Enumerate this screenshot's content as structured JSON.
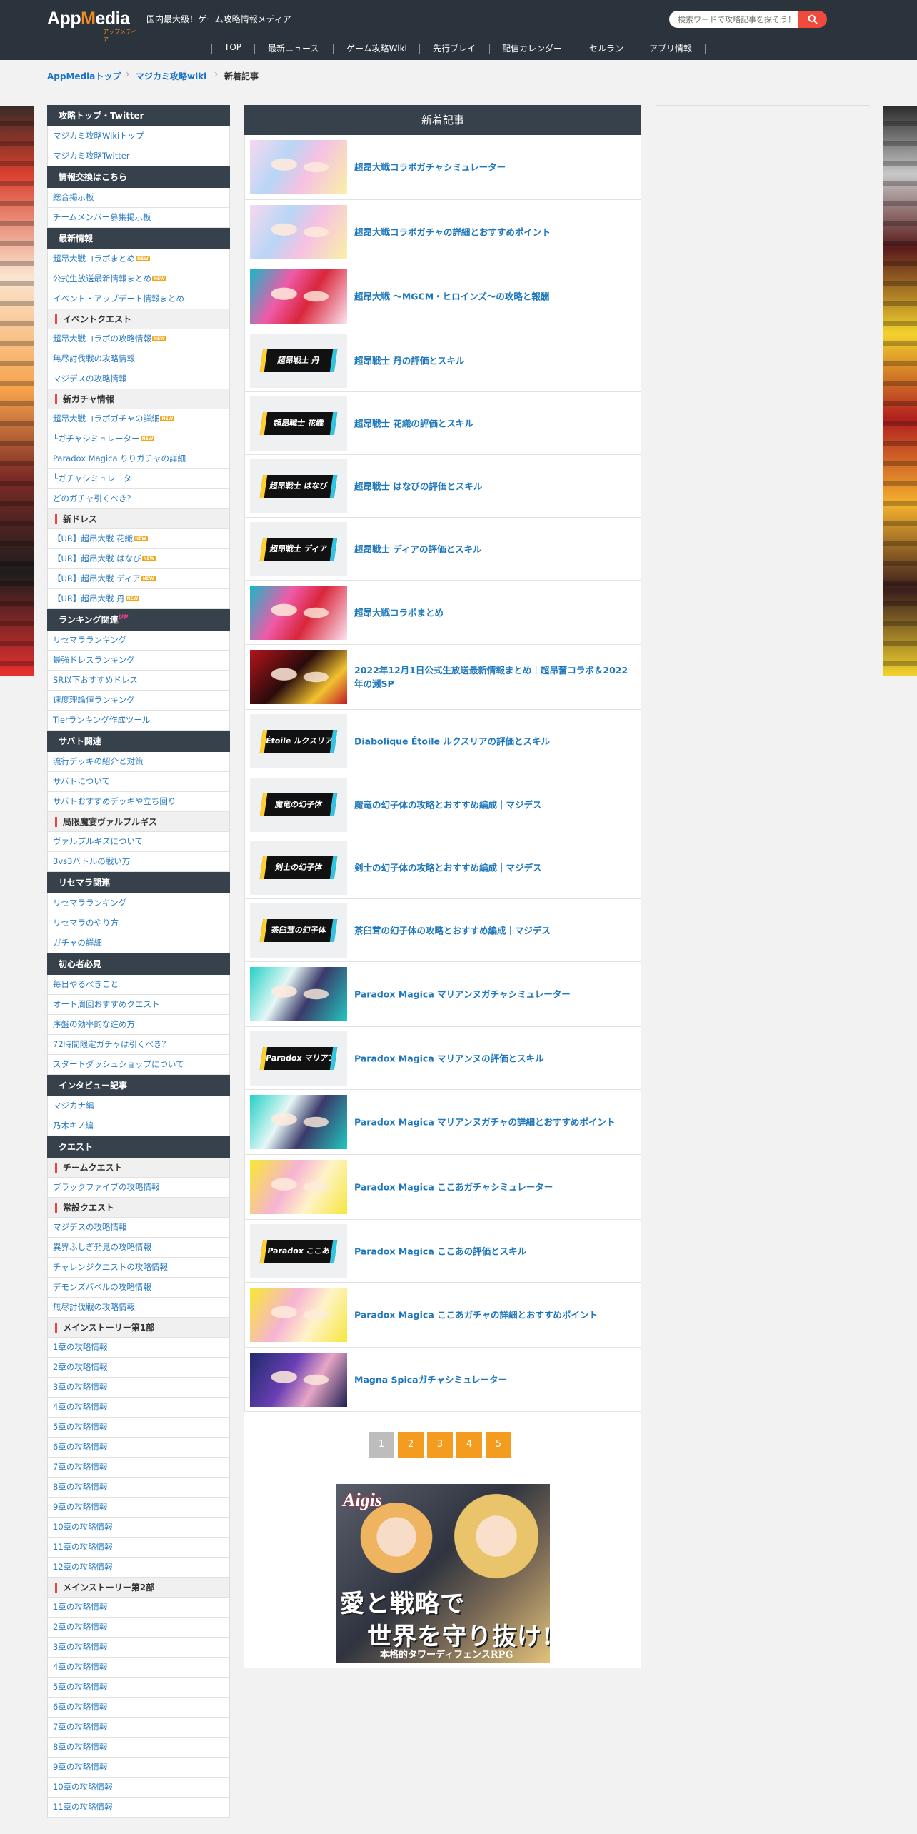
{
  "header": {
    "logo_text_a": "App",
    "logo_text_m": "M",
    "logo_text_b": "edia",
    "logo_kana": "アップメディア",
    "tagline": "国内最大級！ゲーム攻略情報メディア",
    "search_placeholder": "検索ワードで攻略記事を探そう！",
    "nav": [
      "TOP",
      "最新ニュース",
      "ゲーム攻略Wiki",
      "先行プレイ",
      "配信カレンダー",
      "セルラン",
      "アプリ情報"
    ]
  },
  "breadcrumb": {
    "items": [
      "AppMediaトップ",
      "マジカミ攻略wiki"
    ],
    "current": "新着記事"
  },
  "sidebar": {
    "sections": [
      {
        "type": "head",
        "label": "攻略トップ・Twitter"
      },
      {
        "type": "item",
        "label": "マジカミ攻略Wikiトップ"
      },
      {
        "type": "item",
        "label": "マジカミ攻略Twitter"
      },
      {
        "type": "head",
        "label": "情報交換はこちら"
      },
      {
        "type": "item",
        "label": "総合掲示板"
      },
      {
        "type": "item",
        "label": "チームメンバー募集掲示板"
      },
      {
        "type": "head",
        "label": "最新情報"
      },
      {
        "type": "item",
        "label": "超昂大戦コラボまとめ",
        "badge": "NEW"
      },
      {
        "type": "item",
        "label": "公式生放送最新情報まとめ",
        "badge": "NEW"
      },
      {
        "type": "item",
        "label": "イベント・アップデート情報まとめ"
      },
      {
        "type": "sub",
        "label": "イベントクエスト"
      },
      {
        "type": "item",
        "label": "超昂大戦コラボの攻略情報",
        "badge": "NEW"
      },
      {
        "type": "item",
        "label": "無尽討伐戦の攻略情報"
      },
      {
        "type": "item",
        "label": "マジデスの攻略情報"
      },
      {
        "type": "sub",
        "label": "新ガチャ情報"
      },
      {
        "type": "item",
        "label": "超昂大戦コラボガチャの詳細",
        "badge": "NEW"
      },
      {
        "type": "item",
        "label": "└ガチャシミュレーター",
        "badge": "NEW"
      },
      {
        "type": "item",
        "label": "Paradox Magica りりガチャの詳細"
      },
      {
        "type": "item",
        "label": "└ガチャシミュレーター"
      },
      {
        "type": "item",
        "label": "どのガチャ引くべき？"
      },
      {
        "type": "sub",
        "label": "新ドレス"
      },
      {
        "type": "item",
        "label": "【UR】超昂大戦 花織",
        "badge": "NEW"
      },
      {
        "type": "item",
        "label": "【UR】超昂大戦 はなび",
        "badge": "NEW"
      },
      {
        "type": "item",
        "label": "【UR】超昂大戦 ディア",
        "badge": "NEW"
      },
      {
        "type": "item",
        "label": "【UR】超昂大戦 丹",
        "badge": "NEW"
      },
      {
        "type": "head",
        "label": "ランキング関連",
        "up": "UP"
      },
      {
        "type": "item",
        "label": "リセマラランキング"
      },
      {
        "type": "item",
        "label": "最強ドレスランキング"
      },
      {
        "type": "item",
        "label": "SR以下おすすめドレス"
      },
      {
        "type": "item",
        "label": "速度理論値ランキング"
      },
      {
        "type": "item",
        "label": "Tierランキング作成ツール"
      },
      {
        "type": "head",
        "label": "サバト関連"
      },
      {
        "type": "item",
        "label": "流行デッキの紹介と対策"
      },
      {
        "type": "item",
        "label": "サバトについて"
      },
      {
        "type": "item",
        "label": "サバトおすすめデッキや立ち回り"
      },
      {
        "type": "sub",
        "label": "局限魔宴ヴァルプルギス"
      },
      {
        "type": "item",
        "label": "ヴァルプルギスについて"
      },
      {
        "type": "item",
        "label": "3vs3バトルの戦い方"
      },
      {
        "type": "head",
        "label": "リセマラ関連"
      },
      {
        "type": "item",
        "label": "リセマラランキング"
      },
      {
        "type": "item",
        "label": "リセマラのやり方"
      },
      {
        "type": "item",
        "label": "ガチャの詳細"
      },
      {
        "type": "head",
        "label": "初心者必見"
      },
      {
        "type": "item",
        "label": "毎日やるべきこと"
      },
      {
        "type": "item",
        "label": "オート周回おすすめクエスト"
      },
      {
        "type": "item",
        "label": "序盤の効率的な進め方"
      },
      {
        "type": "item",
        "label": "72時間限定ガチャは引くべき？"
      },
      {
        "type": "item",
        "label": "スタートダッシュショップについて"
      },
      {
        "type": "head",
        "label": "インタビュー記事"
      },
      {
        "type": "item",
        "label": "マジカナ編"
      },
      {
        "type": "item",
        "label": "乃木キノ編"
      },
      {
        "type": "head",
        "label": "クエスト"
      },
      {
        "type": "sub",
        "label": "チームクエスト"
      },
      {
        "type": "item",
        "label": "ブラックファイブの攻略情報"
      },
      {
        "type": "sub",
        "label": "常設クエスト"
      },
      {
        "type": "item",
        "label": "マジデスの攻略情報"
      },
      {
        "type": "item",
        "label": "異界ふしぎ発見の攻略情報"
      },
      {
        "type": "item",
        "label": "チャレンジクエストの攻略情報"
      },
      {
        "type": "item",
        "label": "デモンズバベルの攻略情報"
      },
      {
        "type": "item",
        "label": "無尽討伐戦の攻略情報"
      },
      {
        "type": "sub",
        "label": "メインストーリー第1部"
      },
      {
        "type": "item",
        "label": "1章の攻略情報"
      },
      {
        "type": "item",
        "label": "2章の攻略情報"
      },
      {
        "type": "item",
        "label": "3章の攻略情報"
      },
      {
        "type": "item",
        "label": "4章の攻略情報"
      },
      {
        "type": "item",
        "label": "5章の攻略情報"
      },
      {
        "type": "item",
        "label": "6章の攻略情報"
      },
      {
        "type": "item",
        "label": "7章の攻略情報"
      },
      {
        "type": "item",
        "label": "8章の攻略情報"
      },
      {
        "type": "item",
        "label": "9章の攻略情報"
      },
      {
        "type": "item",
        "label": "10章の攻略情報"
      },
      {
        "type": "item",
        "label": "11章の攻略情報"
      },
      {
        "type": "item",
        "label": "12章の攻略情報"
      },
      {
        "type": "sub",
        "label": "メインストーリー第2部"
      },
      {
        "type": "item",
        "label": "1章の攻略情報"
      },
      {
        "type": "item",
        "label": "2章の攻略情報"
      },
      {
        "type": "item",
        "label": "3章の攻略情報"
      },
      {
        "type": "item",
        "label": "4章の攻略情報"
      },
      {
        "type": "item",
        "label": "5章の攻略情報"
      },
      {
        "type": "item",
        "label": "6章の攻略情報"
      },
      {
        "type": "item",
        "label": "7章の攻略情報"
      },
      {
        "type": "item",
        "label": "8章の攻略情報"
      },
      {
        "type": "item",
        "label": "9章の攻略情報"
      },
      {
        "type": "item",
        "label": "10章の攻略情報"
      },
      {
        "type": "item",
        "label": "11章の攻略情報"
      }
    ]
  },
  "main": {
    "title": "新着記事",
    "articles": [
      {
        "title": "超昂大戦コラボガチャシミュレーター",
        "thumb": "pastel",
        "label": ""
      },
      {
        "title": "超昂大戦コラボガチャの詳細とおすすめポイント",
        "thumb": "pastel",
        "label": ""
      },
      {
        "title": "超昂大戦 ～MGCM・ヒロインズ～の攻略と報酬",
        "thumb": "pink-red",
        "label": ""
      },
      {
        "title": "超昂戦士 丹の評価とスキル",
        "thumb": "banner",
        "label": "超昂戦士 丹"
      },
      {
        "title": "超昂戦士 花織の評価とスキル",
        "thumb": "banner",
        "label": "超昂戦士 花織"
      },
      {
        "title": "超昂戦士 はなびの評価とスキル",
        "thumb": "banner",
        "label": "超昂戦士 はなび"
      },
      {
        "title": "超昂戦士 ディアの評価とスキル",
        "thumb": "banner",
        "label": "超昂戦士 ディア"
      },
      {
        "title": "超昂大戦コラボまとめ",
        "thumb": "pink-red",
        "label": ""
      },
      {
        "title": "2022年12月1日公式生放送最新情報まとめ｜超昂奮コラボ＆2022年の瀬SP",
        "thumb": "stream",
        "label": ""
      },
      {
        "title": "Diabolique Étoile ルクスリアの評価とスキル",
        "thumb": "banner",
        "label": "Étoile ルクスリア"
      },
      {
        "title": "魔竜の幻子体の攻略とおすすめ編成｜マジデス",
        "thumb": "banner",
        "label": "魔竜の幻子体"
      },
      {
        "title": "剣士の幻子体の攻略とおすすめ編成｜マジデス",
        "thumb": "banner",
        "label": "剣士の幻子体"
      },
      {
        "title": "茶臼茸の幻子体の攻略とおすすめ編成｜マジデス",
        "thumb": "banner",
        "label": "茶臼茸の幻子体"
      },
      {
        "title": "Paradox Magica マリアンヌガチャシミュレーター",
        "thumb": "teal",
        "label": ""
      },
      {
        "title": "Paradox Magica マリアンヌの評価とスキル",
        "thumb": "banner",
        "label": "Paradox マリアンヌ"
      },
      {
        "title": "Paradox Magica マリアンヌガチャの詳細とおすすめポイント",
        "thumb": "teal",
        "label": ""
      },
      {
        "title": "Paradox Magica ここあガチャシミュレーター",
        "thumb": "yellow",
        "label": ""
      },
      {
        "title": "Paradox Magica ここあの評価とスキル",
        "thumb": "banner",
        "label": "Paradox ここあ"
      },
      {
        "title": "Paradox Magica ここあガチャの詳細とおすすめポイント",
        "thumb": "yellow",
        "label": ""
      },
      {
        "title": "Magna Spicaガチャシミュレーター",
        "thumb": "navy",
        "label": ""
      }
    ],
    "pages": [
      "1",
      "2",
      "3",
      "4",
      "5"
    ],
    "current_page": "1"
  },
  "ad": {
    "logo": "Aigis",
    "line1": "愛と戦略で",
    "line2": "世界を守り抜け!",
    "line3": "本格的タワーディフェンスRPG"
  },
  "colors": {
    "header_bg": "#2b333c",
    "accent_orange": "#f39c1f",
    "search_red": "#ef4a3c",
    "link_blue": "#1f78bd",
    "sidebar_head": "#37414b"
  }
}
